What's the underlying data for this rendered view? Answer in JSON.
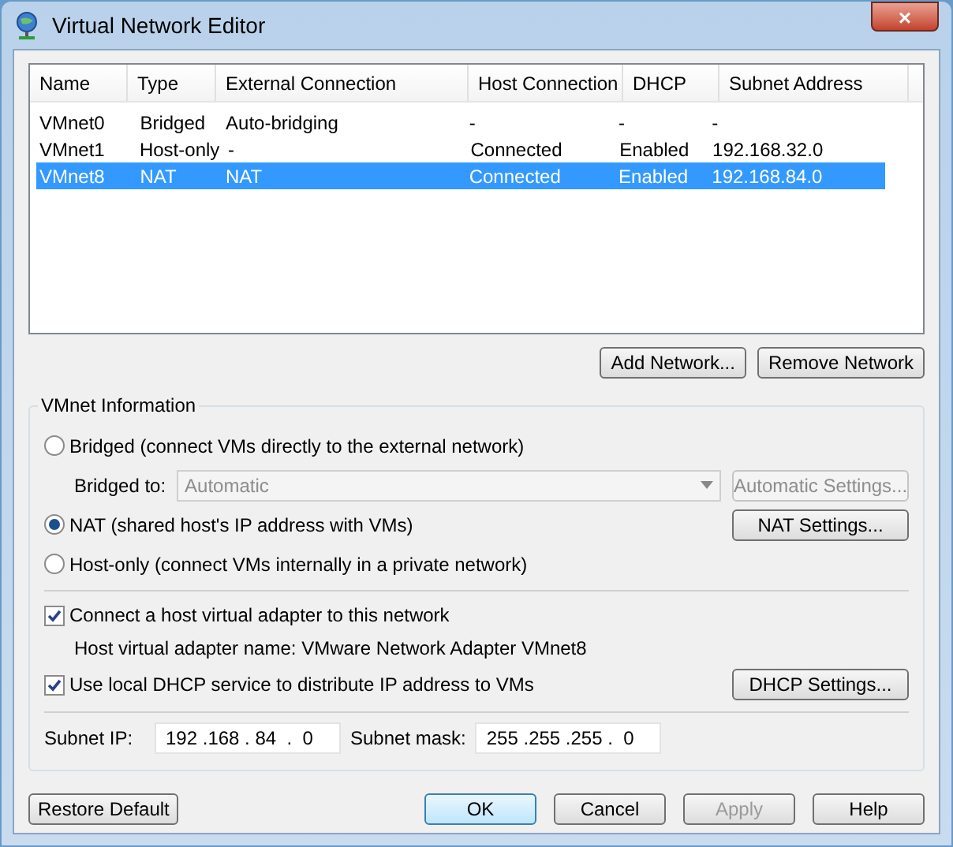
{
  "window": {
    "title": "Virtual Network Editor",
    "close": "×"
  },
  "table": {
    "columns": [
      "Name",
      "Type",
      "External Connection",
      "Host Connection",
      "DHCP",
      "Subnet Address"
    ],
    "rows": [
      {
        "cells": [
          "VMnet0",
          "Bridged",
          "Auto-bridging",
          "-",
          "-",
          "-"
        ],
        "selected": false
      },
      {
        "cells": [
          "VMnet1",
          "Host-only",
          "-",
          "Connected",
          "Enabled",
          "192.168.32.0"
        ],
        "selected": false
      },
      {
        "cells": [
          "VMnet8",
          "NAT",
          "NAT",
          "Connected",
          "Enabled",
          "192.168.84.0"
        ],
        "selected": true
      }
    ]
  },
  "table_buttons": [
    "Add Network...",
    "Remove Network"
  ],
  "info": {
    "title": "VMnet Information",
    "modes": [
      {
        "label": "Bridged (connect VMs directly to the external network)",
        "selected": false
      },
      {
        "label": "NAT (shared host's IP address with VMs)",
        "selected": true,
        "button": "NAT Settings..."
      },
      {
        "label": "Host-only (connect VMs internally in a private network)",
        "selected": false
      }
    ],
    "bridged_to": {
      "label": "Bridged to:",
      "value": "Automatic",
      "disabled": true,
      "button": "Automatic Settings..."
    },
    "host_adapter": {
      "label": "Connect a host virtual adapter to this network",
      "checked": true,
      "detail": "Host virtual adapter name: VMware Network Adapter VMnet8"
    },
    "dhcp": {
      "label": "Use local DHCP service to distribute IP address to VMs",
      "checked": true,
      "button": "DHCP Settings..."
    },
    "subnet_ip": {
      "label": "Subnet IP:",
      "value": "192 .168 . 84  .  0"
    },
    "subnet_mask": {
      "label": "Subnet mask:",
      "value": "255 .255 .255 .  0"
    }
  },
  "footer": {
    "restore": "Restore Default",
    "buttons": [
      {
        "label": "OK",
        "default": true,
        "disabled": false
      },
      {
        "label": "Cancel",
        "default": false,
        "disabled": false
      },
      {
        "label": "Apply",
        "default": false,
        "disabled": true
      },
      {
        "label": "Help",
        "default": false,
        "disabled": false
      }
    ]
  }
}
